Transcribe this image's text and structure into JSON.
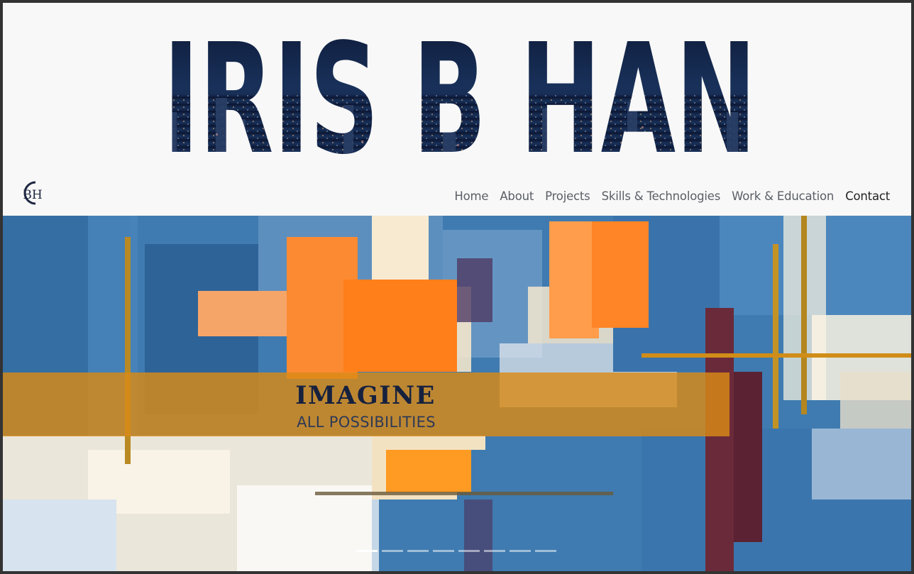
{
  "header": {
    "site_title": "IRIS B HAN",
    "logo_text": "BH"
  },
  "nav": {
    "items": [
      "Home",
      "About",
      "Projects",
      "Skills & Technologies",
      "Work & Education",
      "Contact"
    ],
    "active_index": 5
  },
  "carousel": {
    "slide_title": "IMAGINE",
    "slide_subtitle": "ALL POSSIBILITIES",
    "indicator_count": 8,
    "active_indicator": 0
  },
  "colors": {
    "title_navy": "#16213e",
    "caption_band": "#d98a16",
    "paint_blue": "#2f6fa8",
    "paint_orange": "#ff8c1a"
  }
}
